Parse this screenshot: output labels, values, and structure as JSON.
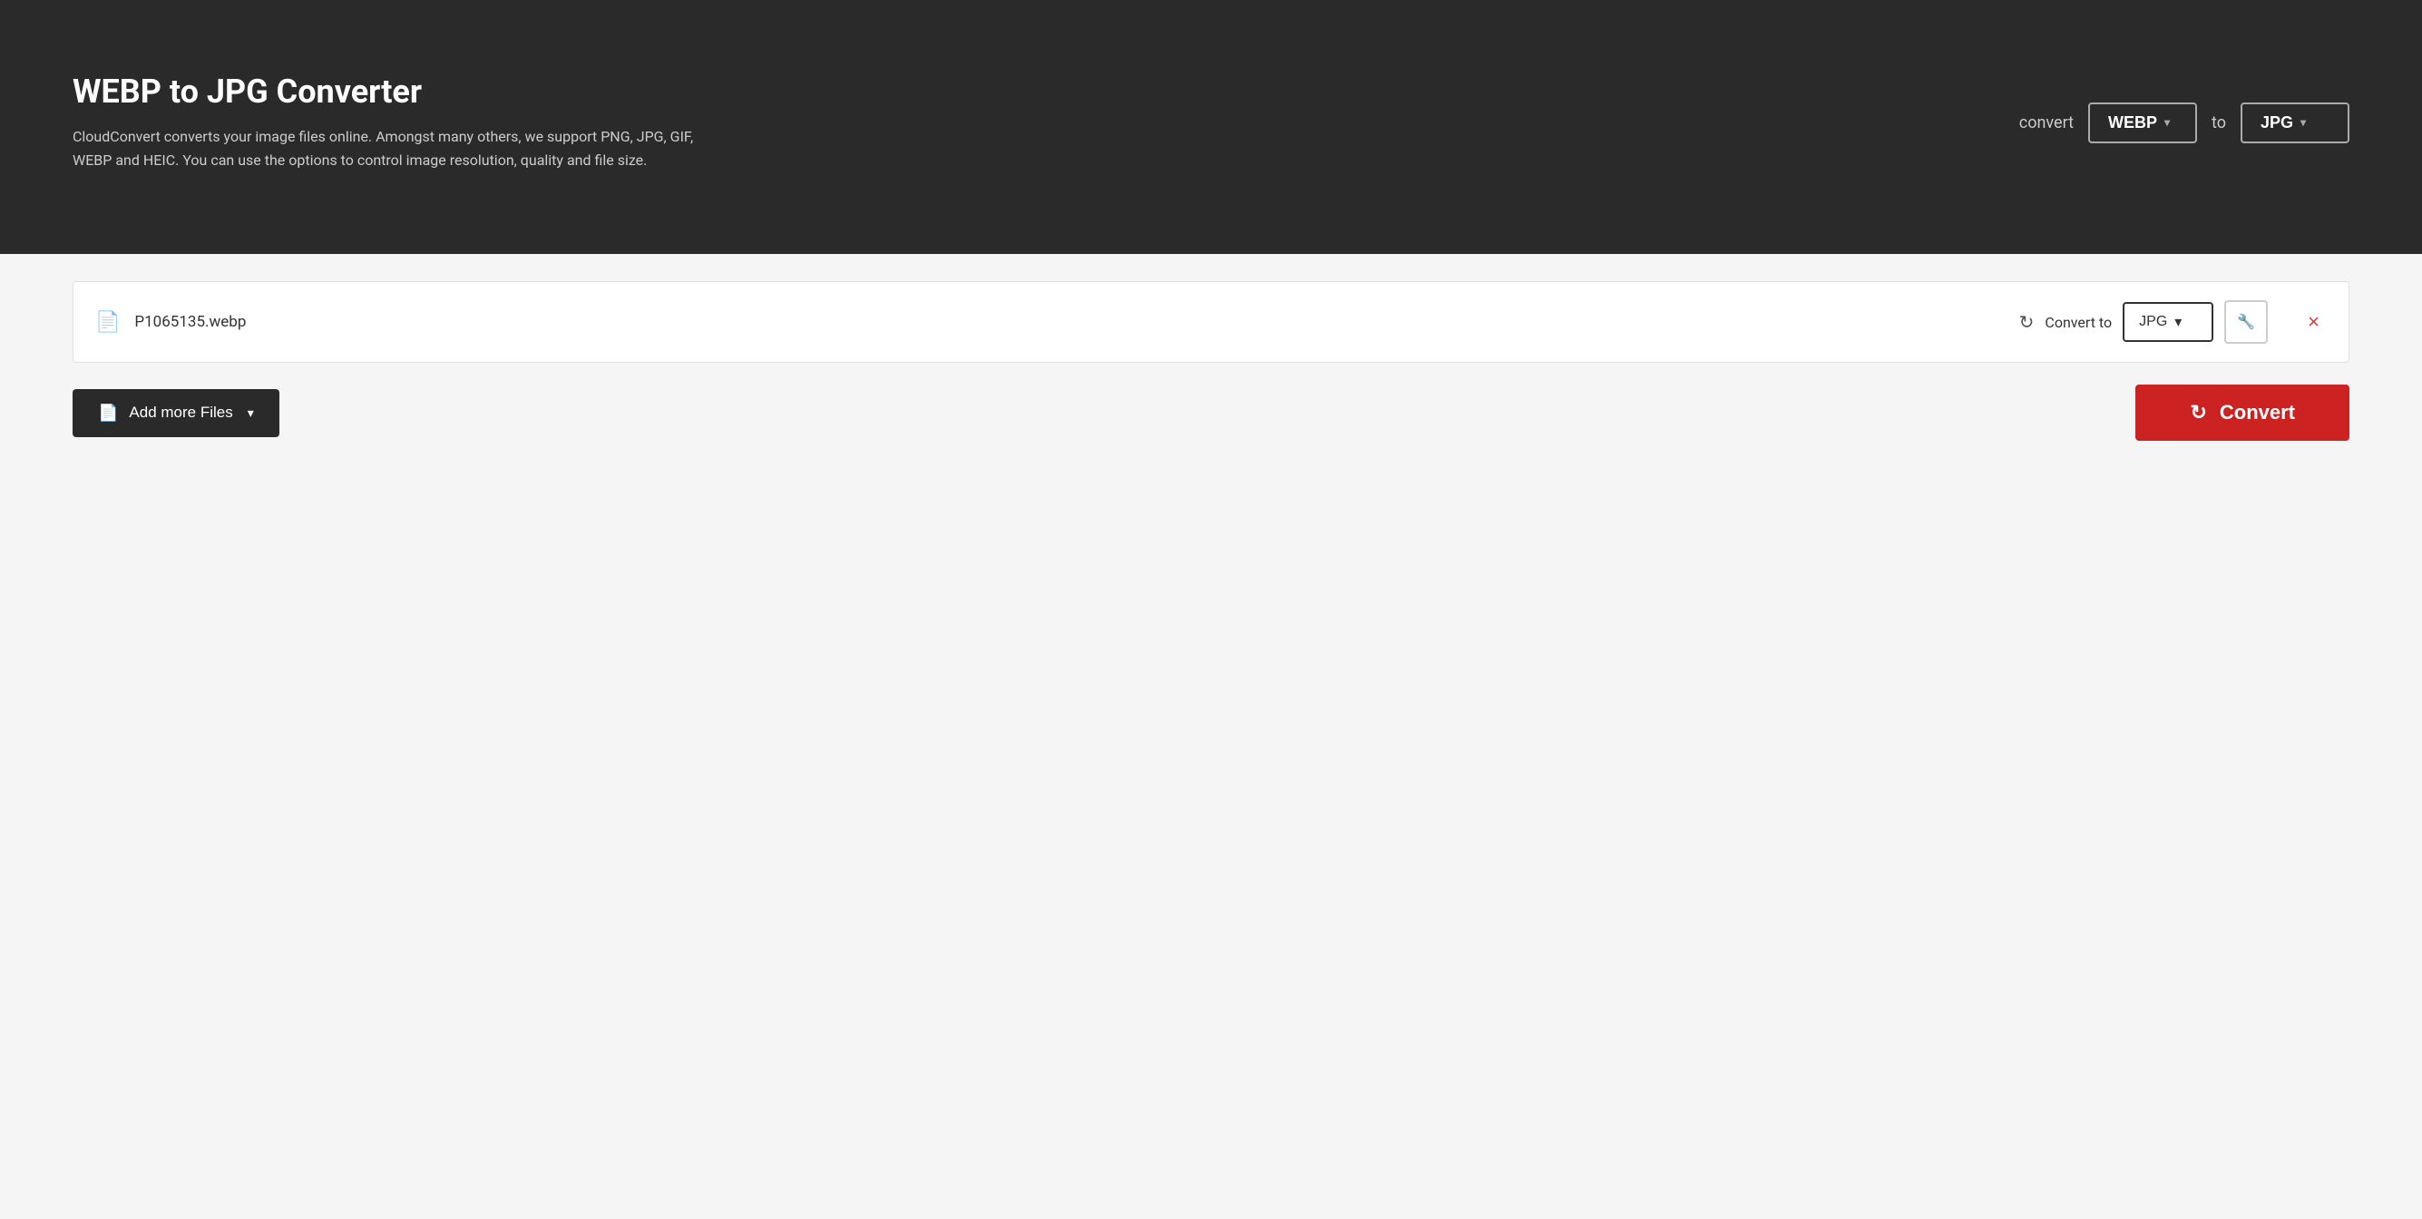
{
  "header": {
    "title": "WEBP to JPG Converter",
    "description": "CloudConvert converts your image files online. Amongst many others, we support PNG, JPG, GIF, WEBP and HEIC. You can use the options to control image resolution, quality and file size.",
    "converter_label": "convert",
    "converter_to": "to",
    "from_format": "WEBP",
    "to_format": "JPG"
  },
  "file_list": [
    {
      "name": "P1065135.webp",
      "convert_to_label": "Convert to",
      "format": "JPG"
    }
  ],
  "actions": {
    "add_files_label": "Add more Files",
    "convert_label": "Convert"
  },
  "icons": {
    "chevron": "▾",
    "refresh": "↻",
    "file": "📄",
    "wrench": "🔧",
    "close": "×",
    "add_file": "📄"
  }
}
